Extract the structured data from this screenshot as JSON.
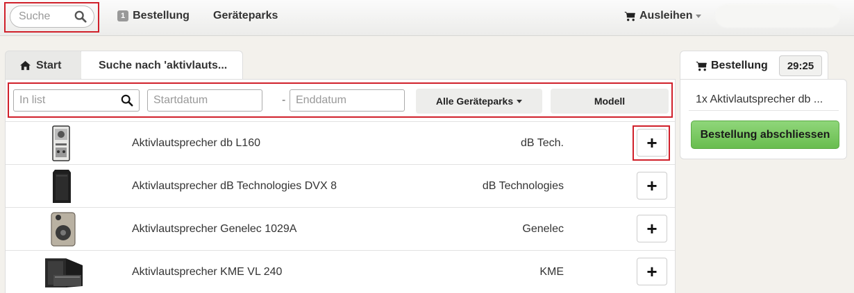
{
  "navbar": {
    "search_placeholder": "Suche",
    "order_count": "1",
    "order_label": "Bestellung",
    "parks_label": "Geräteparks",
    "rent_label": "Ausleihen"
  },
  "breadcrumb": {
    "start_label": "Start",
    "search_label": "Suche nach 'aktivlauts..."
  },
  "filters": {
    "list_placeholder": "In list",
    "start_placeholder": "Startdatum",
    "separator": "-",
    "end_placeholder": "Enddatum",
    "parks_dropdown": "Alle Geräteparks",
    "model_button": "Modell"
  },
  "products": [
    {
      "name": "Aktivlautsprecher db L160",
      "brand": "dB Tech.",
      "add_label": "+"
    },
    {
      "name": "Aktivlautsprecher dB Technologies DVX 8",
      "brand": "dB Technologies",
      "add_label": "+"
    },
    {
      "name": "Aktivlautsprecher Genelec 1029A",
      "brand": "Genelec",
      "add_label": "+"
    },
    {
      "name": "Aktivlautsprecher KME VL 240",
      "brand": "KME",
      "add_label": "+"
    }
  ],
  "order": {
    "title": "Bestellung",
    "timer": "29:25",
    "item": "1x Aktivlautsprecher db ...",
    "checkout": "Bestellung abschliessen"
  },
  "colors": {
    "highlight": "#d0202a",
    "checkout_green": "#7ccb63"
  }
}
